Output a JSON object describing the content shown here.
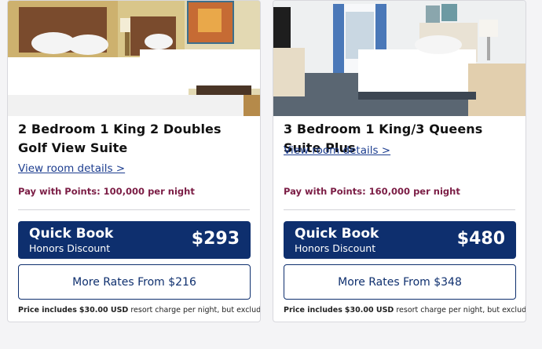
{
  "rooms": [
    {
      "title": "2 Bedroom 1 King 2 Doubles Golf View Suite",
      "details_link": "View room details >",
      "points": "Pay with Points: 100,000 per night",
      "quick_book_title": "Quick Book",
      "quick_book_subtitle": "Honors Discount",
      "quick_book_price": "$293",
      "more_rates": "More Rates From $216",
      "price_note_prefix": "Price includes",
      "price_note_amount": "$30.00 USD",
      "price_note_suffix": "resort charge per night, but excludes tax"
    },
    {
      "title": "3 Bedroom 1 King/3 Queens Suite Plus",
      "details_link": "View room details >",
      "points": "Pay with Points: 160,000 per night",
      "quick_book_title": "Quick Book",
      "quick_book_subtitle": "Honors Discount",
      "quick_book_price": "$480",
      "more_rates": "More Rates From $348",
      "price_note_prefix": "Price includes",
      "price_note_amount": "$30.00 USD",
      "price_note_suffix": "resort charge per night, but excludes tax"
    }
  ],
  "colors": {
    "brand_navy": "#0e2f6e",
    "link_blue": "#1c3d8f",
    "points_maroon": "#7b1d45"
  }
}
